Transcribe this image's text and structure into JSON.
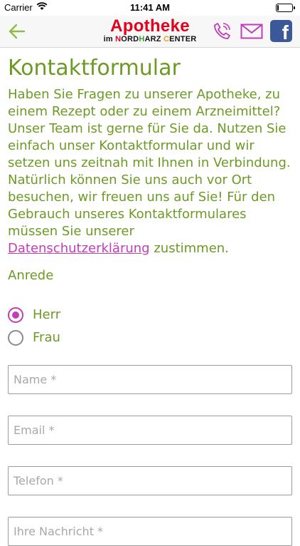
{
  "status_bar": {
    "carrier": "Carrier",
    "time": "11:41 AM",
    "battery_level": 0.1
  },
  "nav": {
    "back_icon": "arrow-left-icon",
    "logo_title": "Apotheke",
    "logo_subtitle_prefix": "im ",
    "logo_subtitle_parts": [
      "N",
      "ORD",
      "H",
      "ARZ ",
      "C",
      "ENTER"
    ],
    "phone_icon": "phone-icon",
    "mail_icon": "mail-icon",
    "facebook_label": "f"
  },
  "page": {
    "title": "Kontaktformular",
    "intro_text": "Haben Sie Fragen zu unserer Apotheke, zu einem Rezept oder zu einem Arzneimittel? Unser Team ist gerne für Sie da. Nutzen Sie einfach unser Kontaktformular und wir setzen uns zeitnah mit Ihnen in Verbindung. Natürlich können Sie uns auch vor Ort besuchen, wir freuen uns auf Sie! Für den Gebrauch unseres Kontaktformulares müssen Sie unserer",
    "privacy_link": "Datenschutzerklärung",
    "intro_suffix": " zustimmen."
  },
  "form": {
    "salutation_label": "Anrede",
    "options": [
      {
        "label": "Herr",
        "selected": true
      },
      {
        "label": "Frau",
        "selected": false
      }
    ],
    "name_placeholder": "Name *",
    "email_placeholder": "Email *",
    "phone_placeholder": "Telefon *",
    "message_placeholder": "Ihre Nachricht *"
  },
  "colors": {
    "accent_green": "#6d9a25",
    "accent_magenta": "#c13db8",
    "logo_red": "#e3001b",
    "facebook_blue": "#3b5998"
  }
}
